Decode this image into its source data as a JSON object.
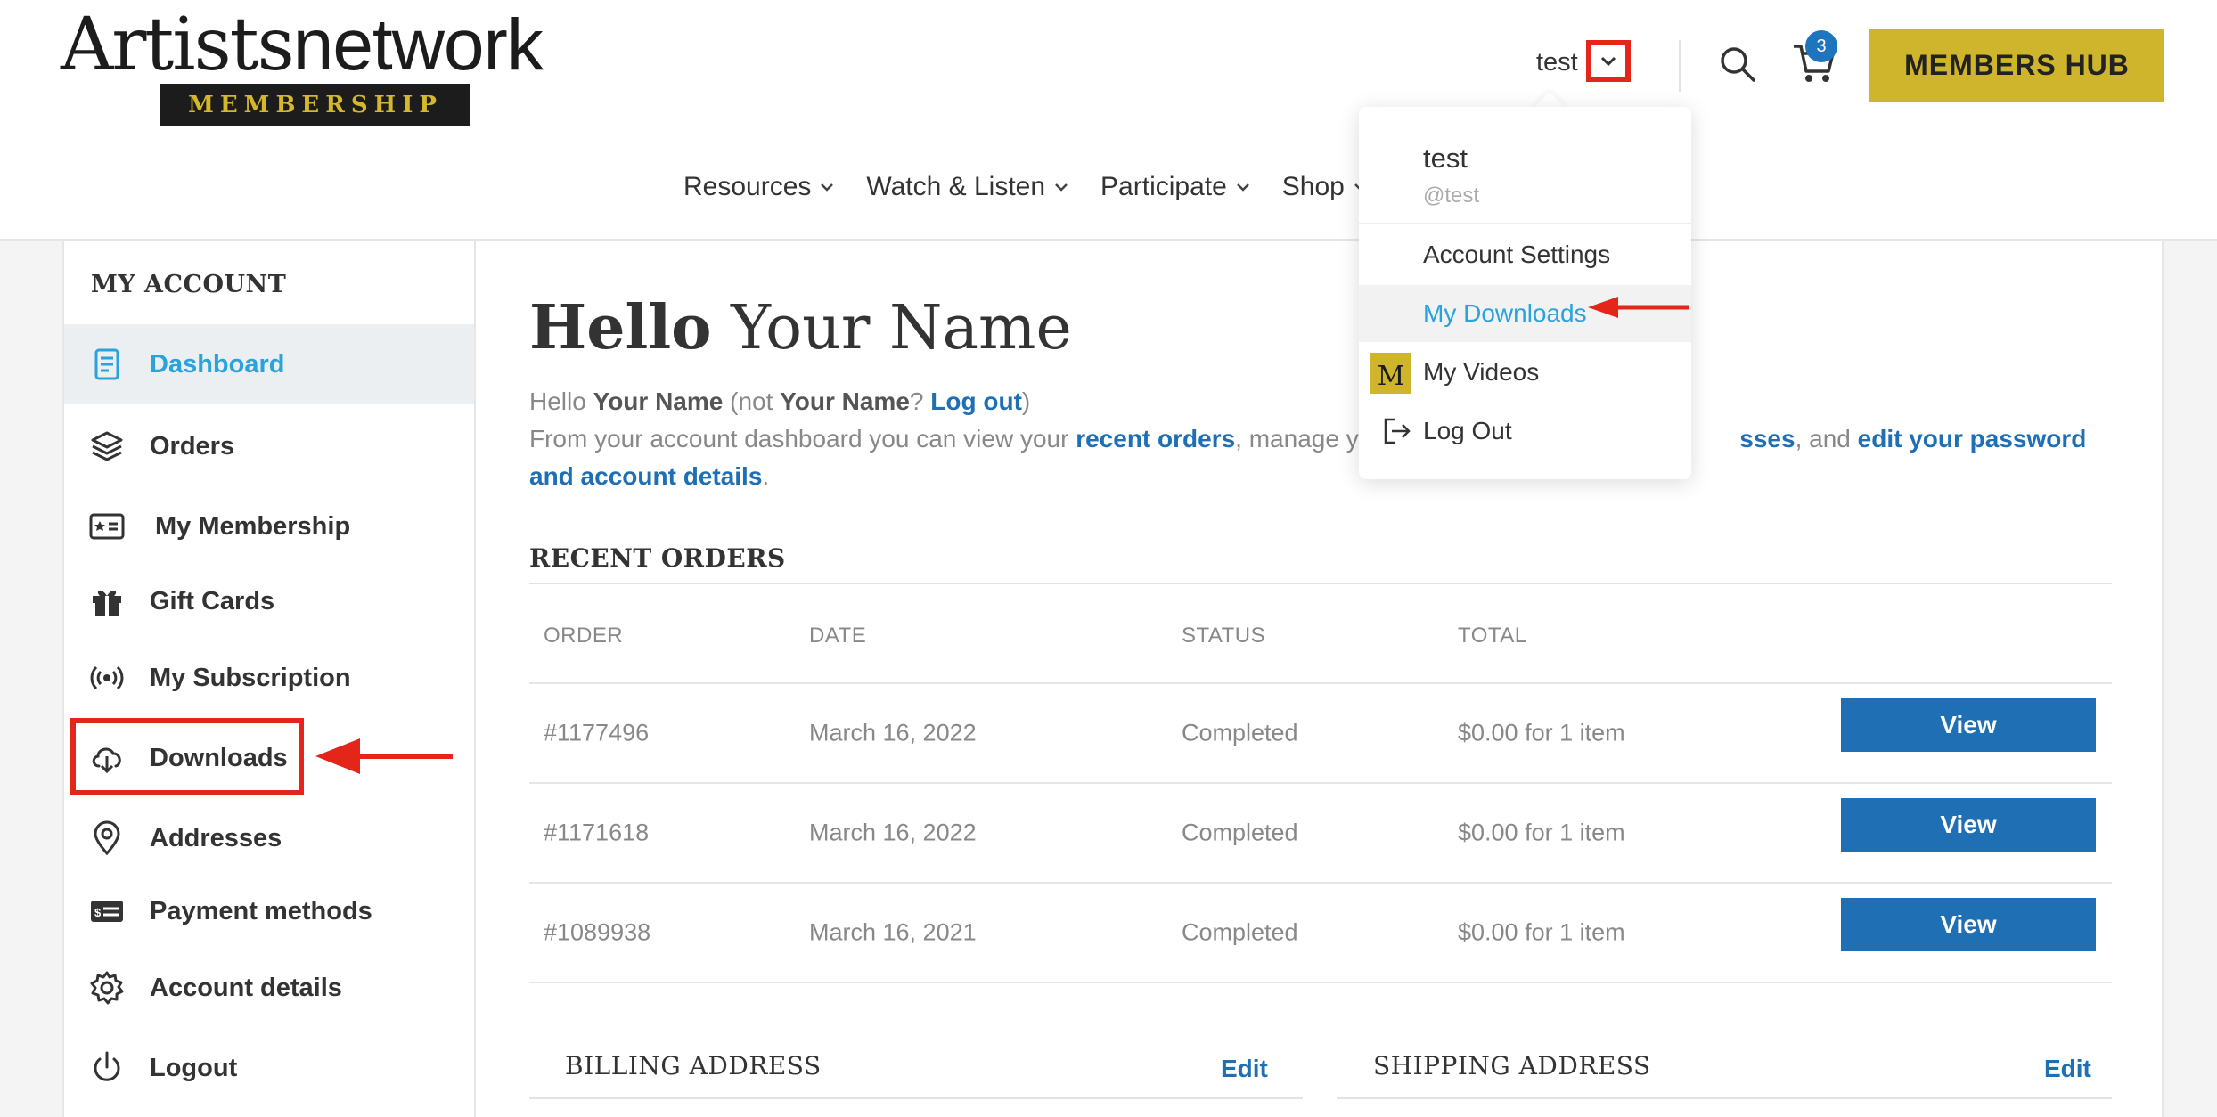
{
  "logo": {
    "text_bold": "Artists",
    "text_thin": "network",
    "subtitle": "MEMBERSHIP"
  },
  "header": {
    "username": "test",
    "cart_count": "3",
    "members_hub_label": "MEMBERS HUB",
    "nav": [
      {
        "label": "Resources"
      },
      {
        "label": "Watch & Listen"
      },
      {
        "label": "Participate"
      },
      {
        "label": "Shop"
      }
    ]
  },
  "dropdown": {
    "name": "test",
    "handle": "@test",
    "items": [
      {
        "label": "Account Settings"
      },
      {
        "label": "My Downloads"
      },
      {
        "label": "My Videos"
      },
      {
        "label": "Log Out"
      }
    ]
  },
  "sidebar": {
    "title": "MY ACCOUNT",
    "items": [
      {
        "label": "Dashboard",
        "icon": "dashboard-icon"
      },
      {
        "label": "Orders",
        "icon": "layers-icon"
      },
      {
        "label": "My Membership",
        "icon": "membership-card-icon"
      },
      {
        "label": "Gift Cards",
        "icon": "gift-icon"
      },
      {
        "label": "My Subscription",
        "icon": "broadcast-icon"
      },
      {
        "label": "Downloads",
        "icon": "cloud-download-icon"
      },
      {
        "label": "Addresses",
        "icon": "map-pin-icon"
      },
      {
        "label": "Payment methods",
        "icon": "payment-card-icon"
      },
      {
        "label": "Account details",
        "icon": "gear-icon"
      },
      {
        "label": "Logout",
        "icon": "power-icon"
      }
    ]
  },
  "main": {
    "greeting_bold": "Hello",
    "greeting_rest": "Your Name",
    "intro": {
      "hello": "Hello",
      "name": "Your Name",
      "not": "(not",
      "name2": "Your Name",
      "q": "?",
      "logout_link": "Log out",
      "close": ")",
      "line2_start": "From your account dashboard you can view your",
      "recent_orders_link": "recent orders",
      "line2_mid": ", manage yo",
      "addresses_link": "sses",
      "line2_and": ", and",
      "edit_link": "edit your password and account details",
      "end": "."
    },
    "orders_title": "RECENT ORDERS",
    "orders_headers": [
      "ORDER",
      "DATE",
      "STATUS",
      "TOTAL"
    ],
    "orders": [
      {
        "order": "#1177496",
        "date": "March 16, 2022",
        "status": "Completed",
        "total": "$0.00 for 1 item",
        "action": "View"
      },
      {
        "order": "#1171618",
        "date": "March 16, 2022",
        "status": "Completed",
        "total": "$0.00 for 1 item",
        "action": "View"
      },
      {
        "order": "#1089938",
        "date": "March 16, 2021",
        "status": "Completed",
        "total": "$0.00 for 1 item",
        "action": "View"
      }
    ],
    "billing_title": "BILLING ADDRESS",
    "shipping_title": "SHIPPING ADDRESS",
    "edit_label": "Edit"
  },
  "colors": {
    "accent": "#2aa2db",
    "link": "#1e6fb3",
    "gold": "#cfb52b",
    "annotation": "#e4261a"
  }
}
